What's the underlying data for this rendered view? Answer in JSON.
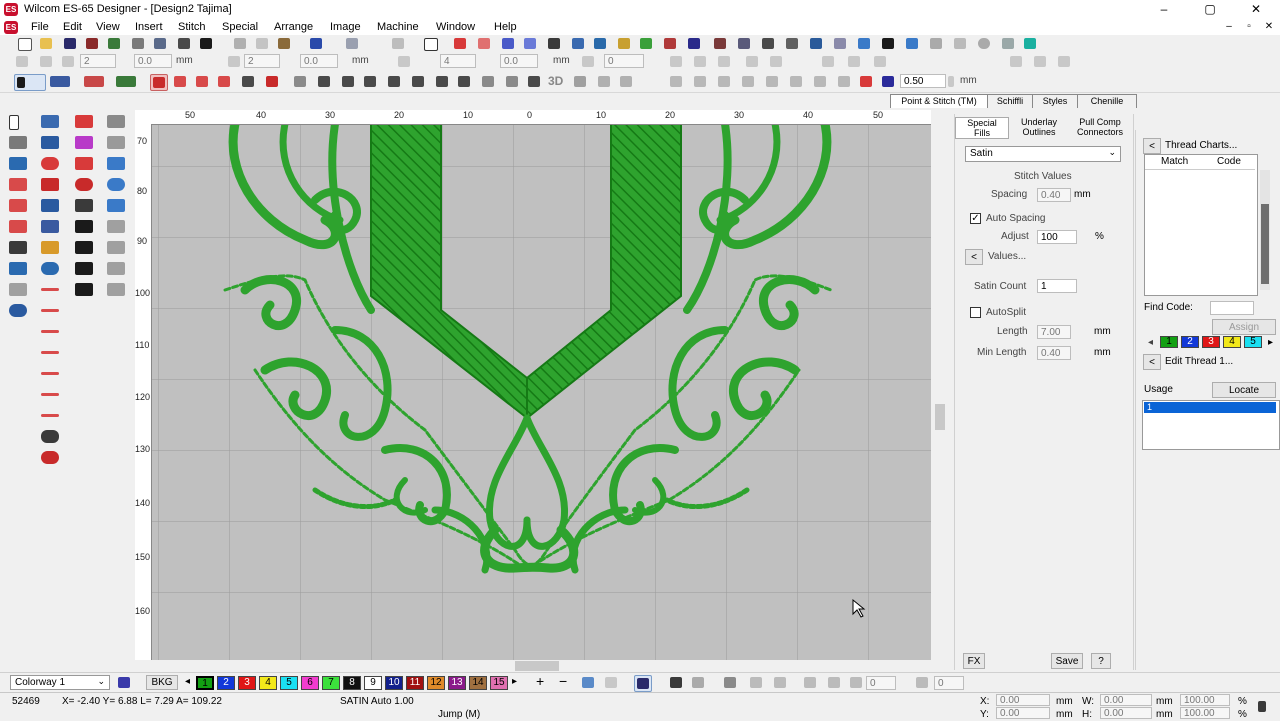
{
  "window": {
    "title": "Wilcom ES-65 Designer - [Design2          Tajima]",
    "app_icon": "ES",
    "minimize": "–",
    "maximize": "▢",
    "close": "✕"
  },
  "menu": [
    "File",
    "Edit",
    "View",
    "Insert",
    "Stitch",
    "Special",
    "Arrange",
    "Image",
    "Machine",
    "Window",
    "Help"
  ],
  "mdi": {
    "minimize": "–",
    "restore": "▫",
    "close": "✕"
  },
  "toolbar2": {
    "f1": "2",
    "f2": "0.0",
    "f3": "2",
    "f4": "0.0",
    "f5": "4",
    "f6": "0.0",
    "f7": "0",
    "unit": "mm"
  },
  "toolbar3": {
    "threeD": "3D",
    "zoom_value": "0.50",
    "unit": "mm"
  },
  "rulers": {
    "h": [
      "50",
      "40",
      "30",
      "20",
      "10",
      "0",
      "10",
      "20",
      "30",
      "40",
      "50"
    ],
    "v": [
      "70",
      "80",
      "90",
      "100",
      "110",
      "120",
      "130",
      "140",
      "150",
      "160"
    ]
  },
  "panel_tabs": [
    "Point & Stitch (TM)",
    "Schiffli",
    "Styles",
    "Chenille"
  ],
  "props": {
    "tabs": [
      {
        "l1": "Special",
        "l2": "Fills"
      },
      {
        "l1": "Underlay",
        "l2": "Outlines"
      },
      {
        "l1": "Pull Comp",
        "l2": "Connectors"
      }
    ],
    "fill_type": "Satin",
    "stitch_values": "Stitch Values",
    "spacing_label": "Spacing",
    "spacing_value": "0.40",
    "mm": "mm",
    "auto_spacing": "Auto Spacing",
    "auto_spacing_check": "✓",
    "adjust_label": "Adjust",
    "adjust_value": "100",
    "pct": "%",
    "values_btn": "Values...",
    "satin_count_label": "Satin Count",
    "satin_count_value": "1",
    "autosplit": "AutoSplit",
    "length_label": "Length",
    "length_value": "7.00",
    "min_length_label": "Min Length",
    "min_length_value": "0.40",
    "fx": "FX",
    "save": "Save",
    "help": "?"
  },
  "threads": {
    "charts": "Thread Charts...",
    "col_match": "Match",
    "col_code": "Code",
    "find_code": "Find Code:",
    "assign": "Assign",
    "swatches": [
      {
        "n": "1",
        "c": "#12a012"
      },
      {
        "n": "2",
        "c": "#1238d8"
      },
      {
        "n": "3",
        "c": "#e01616"
      },
      {
        "n": "4",
        "c": "#f2e81a"
      },
      {
        "n": "5",
        "c": "#1ae0f2"
      }
    ],
    "edit_thread": "Edit Thread 1...",
    "usage": "Usage",
    "locate": "Locate",
    "usage_item": "1"
  },
  "palette": {
    "colorway": "Colorway 1",
    "bkg": "BKG",
    "swatches": [
      {
        "n": "1",
        "c": "#12a012"
      },
      {
        "n": "2",
        "c": "#1238d8"
      },
      {
        "n": "3",
        "c": "#e01616"
      },
      {
        "n": "4",
        "c": "#f2e81a"
      },
      {
        "n": "5",
        "c": "#1ae0f2"
      },
      {
        "n": "6",
        "c": "#f23ccf"
      },
      {
        "n": "7",
        "c": "#3ce03c"
      },
      {
        "n": "8",
        "c": "#101010"
      },
      {
        "n": "9",
        "c": "#ffffff"
      },
      {
        "n": "10",
        "c": "#12208c"
      },
      {
        "n": "11",
        "c": "#a01010"
      },
      {
        "n": "12",
        "c": "#e08a2a"
      },
      {
        "n": "13",
        "c": "#8a1a8a"
      },
      {
        "n": "14",
        "c": "#a07040"
      },
      {
        "n": "15",
        "c": "#e070b0"
      }
    ],
    "f1": "0",
    "f2": "0"
  },
  "status": {
    "stitches": "52469",
    "coords": "X=  -2.40 Y=   6.88 L=   7.29 A= 109.22",
    "stitch_type": "SATIN Auto  1.00",
    "jump": "Jump (M)",
    "x_label": "X:",
    "x_val": "0.00",
    "y_label": "Y:",
    "y_val": "0.00",
    "w_label": "W:",
    "w_val": "0.00",
    "h_label": "H:",
    "h_val": "0.00",
    "mm": "mm",
    "pct_val": "100.00",
    "pct": "%"
  },
  "colors": {
    "stitch": "#2ea32e",
    "stitch_dark": "#157a15",
    "canvas": "#c0c0c0",
    "selection": "#0a64d6"
  }
}
